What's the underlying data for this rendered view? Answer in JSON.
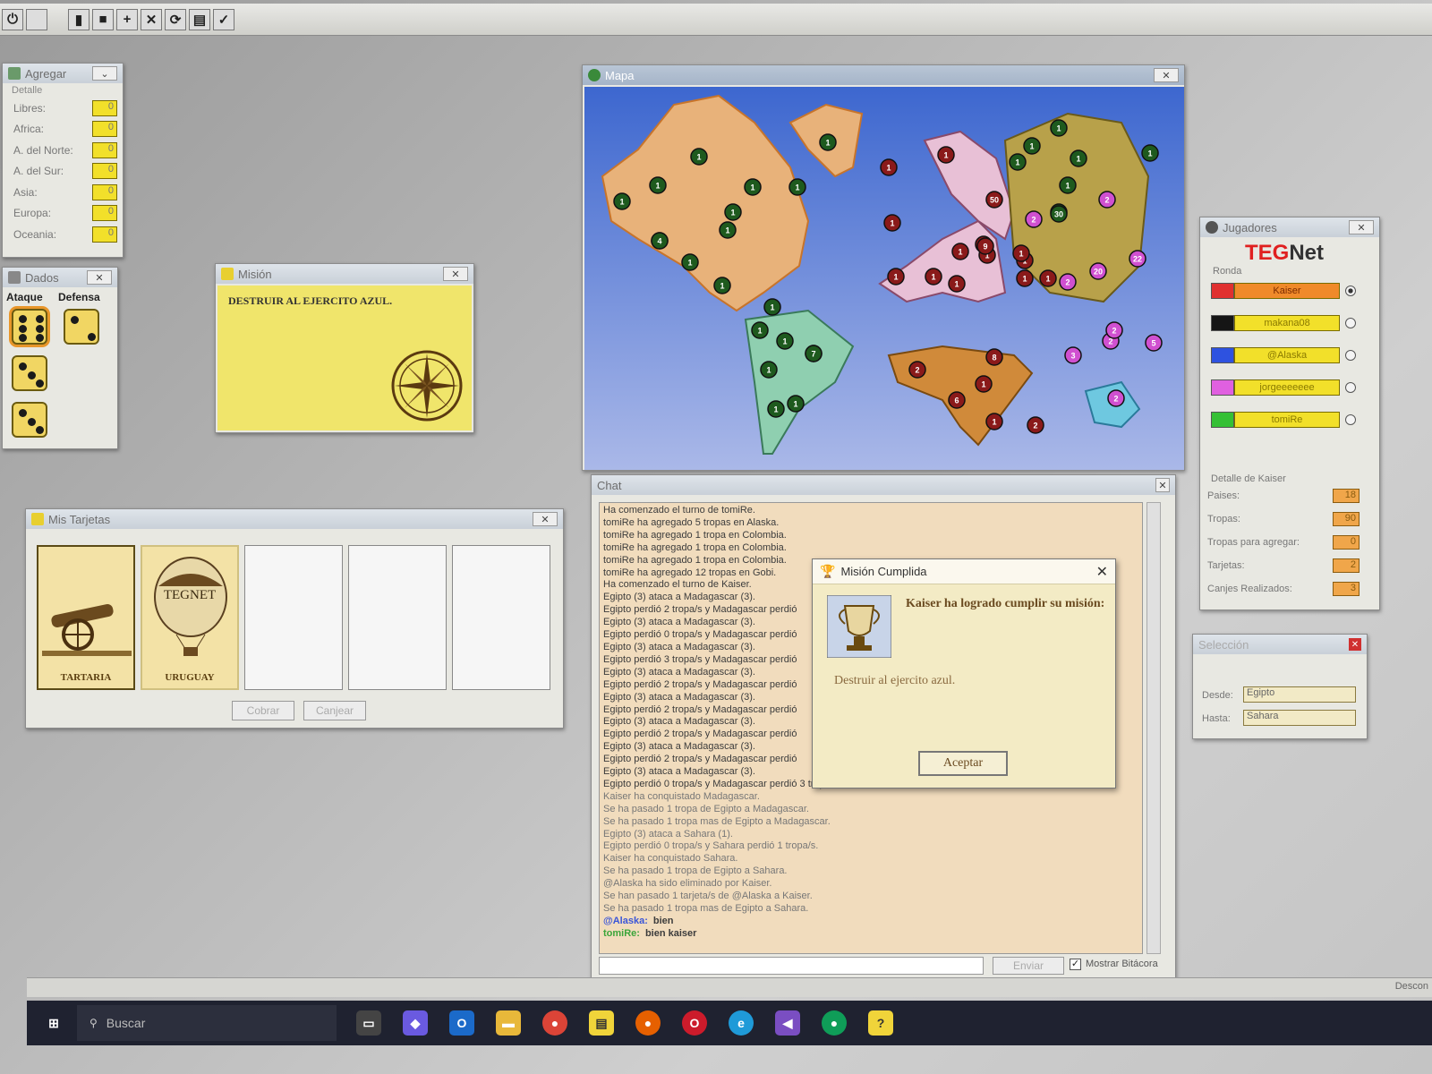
{
  "toolbar": {
    "buttons": [
      "power-icon",
      "blank-icon",
      "pause-icon",
      "stop-icon",
      "add-icon",
      "cancel-icon",
      "reload-icon",
      "book-icon",
      "check-icon"
    ]
  },
  "agregar": {
    "title": "Agregar",
    "group": "Detalle",
    "rows": [
      {
        "label": "Libres:",
        "value": "0"
      },
      {
        "label": "Africa:",
        "value": "0"
      },
      {
        "label": "A. del Norte:",
        "value": "0"
      },
      {
        "label": "A. del Sur:",
        "value": "0"
      },
      {
        "label": "Asia:",
        "value": "0"
      },
      {
        "label": "Europa:",
        "value": "0"
      },
      {
        "label": "Oceania:",
        "value": "0"
      }
    ]
  },
  "dados": {
    "title": "Dados",
    "attack_label": "Ataque",
    "defense_label": "Defensa",
    "attack": [
      6,
      3,
      3
    ],
    "defense": [
      2
    ]
  },
  "mision": {
    "title": "Misión",
    "text": "DESTRUIR AL EJERCITO AZUL."
  },
  "tarjetas": {
    "title": "Mis Tarjetas",
    "cards": [
      {
        "name": "TARTARIA"
      },
      {
        "name": "URUGUAY",
        "badge": "TEGNET"
      }
    ],
    "cobrar": "Cobrar",
    "canjear": "Canjear"
  },
  "mapa": {
    "title": "Mapa",
    "markers": [
      {
        "n": "1"
      },
      {
        "n": "1"
      },
      {
        "n": "1"
      },
      {
        "n": "1"
      },
      {
        "n": "1"
      },
      {
        "n": "1"
      },
      {
        "n": "1"
      },
      {
        "n": "1"
      },
      {
        "n": "1"
      },
      {
        "n": "1"
      },
      {
        "n": "1"
      },
      {
        "n": "1"
      },
      {
        "n": "1"
      },
      {
        "n": "1"
      },
      {
        "n": "1"
      },
      {
        "n": "1"
      },
      {
        "n": "1"
      },
      {
        "n": "1"
      },
      {
        "n": "1"
      },
      {
        "n": "1"
      },
      {
        "n": "1"
      },
      {
        "n": "4"
      },
      {
        "n": "7"
      },
      {
        "n": "1"
      },
      {
        "n": "1"
      },
      {
        "n": "1"
      },
      {
        "n": "1"
      },
      {
        "n": "1"
      },
      {
        "n": "1"
      },
      {
        "n": "1"
      },
      {
        "n": "1"
      },
      {
        "n": "50"
      },
      {
        "n": "2"
      },
      {
        "n": "9"
      },
      {
        "n": "1"
      },
      {
        "n": "1"
      },
      {
        "n": "1"
      },
      {
        "n": "1"
      },
      {
        "n": "1"
      },
      {
        "n": "1"
      },
      {
        "n": "1"
      },
      {
        "n": "1"
      },
      {
        "n": "1"
      },
      {
        "n": "30"
      },
      {
        "n": "2"
      },
      {
        "n": "20"
      },
      {
        "n": "22"
      },
      {
        "n": "2"
      },
      {
        "n": "2"
      },
      {
        "n": "8"
      },
      {
        "n": "1"
      },
      {
        "n": "6"
      },
      {
        "n": "1"
      },
      {
        "n": "2"
      },
      {
        "n": "2"
      },
      {
        "n": "2"
      },
      {
        "n": "3"
      },
      {
        "n": "5"
      },
      {
        "n": "2"
      }
    ]
  },
  "chat": {
    "title": "Chat",
    "lines": [
      "Ha comenzado el turno de tomiRe.",
      "tomiRe ha agregado 5 tropas en Alaska.",
      "tomiRe ha agregado 1 tropa en Colombia.",
      "tomiRe ha agregado 1 tropa en Colombia.",
      "tomiRe ha agregado 1 tropa en Colombia.",
      "tomiRe ha agregado 12 tropas en Gobi.",
      "Ha comenzado el turno de Kaiser.",
      "Egipto (3) ataca a Madagascar (3).",
      "Egipto perdió 2 tropa/s y Madagascar perdió",
      "Egipto (3) ataca a Madagascar (3).",
      "Egipto perdió 0 tropa/s y Madagascar perdió",
      "Egipto (3) ataca a Madagascar (3).",
      "Egipto perdió 3 tropa/s y Madagascar perdió",
      "Egipto (3) ataca a Madagascar (3).",
      "Egipto perdió 2 tropa/s y Madagascar perdió",
      "Egipto (3) ataca a Madagascar (3).",
      "Egipto perdió 2 tropa/s y Madagascar perdió",
      "Egipto (3) ataca a Madagascar (3).",
      "Egipto perdió 2 tropa/s y Madagascar perdió",
      "Egipto (3) ataca a Madagascar (3).",
      "Egipto perdió 2 tropa/s y Madagascar perdió",
      "Egipto (3) ataca a Madagascar (3).",
      "Egipto perdió 0 tropa/s y Madagascar perdió 3 tropa/s.",
      "Kaiser ha conquistado Madagascar.",
      "Se ha pasado 1 tropa de Egipto a Madagascar.",
      "Se ha pasado 1 tropa mas de Egipto a Madagascar.",
      "Egipto (3) ataca a Sahara (1).",
      "Egipto perdió 0 tropa/s y Sahara perdió 1 tropa/s.",
      "Kaiser ha conquistado Sahara.",
      "Se ha pasado 1 tropa de Egipto a Sahara.",
      "@Alaska ha sido eliminado por Kaiser.",
      "Se han pasado 1 tarjeta/s de @Alaska a Kaiser.",
      "Se ha pasado 1 tropa mas de Egipto a Sahara."
    ],
    "messages": [
      {
        "user": "@Alaska:",
        "text": "bien"
      },
      {
        "user": "tomiRe:",
        "text": "bien kaiser"
      }
    ],
    "send_label": "Enviar",
    "show_log_label": "Mostrar Bitácora"
  },
  "dialog": {
    "title": "Misión Cumplida",
    "heading": "Kaiser ha logrado cumplir su misión:",
    "body": "Destruir al ejercito azul.",
    "ok": "Aceptar"
  },
  "jugadores": {
    "title": "Jugadores",
    "logo_a": "TEG",
    "logo_b": "Net",
    "round_label": "Ronda",
    "players": [
      {
        "name": "Kaiser",
        "color": "#e03030"
      },
      {
        "name": "makana08",
        "color": "#151515"
      },
      {
        "name": "@Alaska",
        "color": "#2e52e0"
      },
      {
        "name": "jorgeeeeeee",
        "color": "#e060e0"
      },
      {
        "name": "tomiRe",
        "color": "#35c035"
      }
    ],
    "detail_title": "Detalle de Kaiser",
    "details": [
      {
        "label": "Paises:",
        "value": "18"
      },
      {
        "label": "Tropas:",
        "value": "90"
      },
      {
        "label": "Tropas para agregar:",
        "value": "0"
      },
      {
        "label": "Tarjetas:",
        "value": "2"
      },
      {
        "label": "Canjes Realizados:",
        "value": "3"
      }
    ]
  },
  "seleccion": {
    "title": "Selección",
    "desde_label": "Desde:",
    "desde": "Egipto",
    "hasta_label": "Hasta:",
    "hasta": "Sahara"
  },
  "taskbar": {
    "search_placeholder": "Buscar",
    "desconectar": "Descon"
  }
}
